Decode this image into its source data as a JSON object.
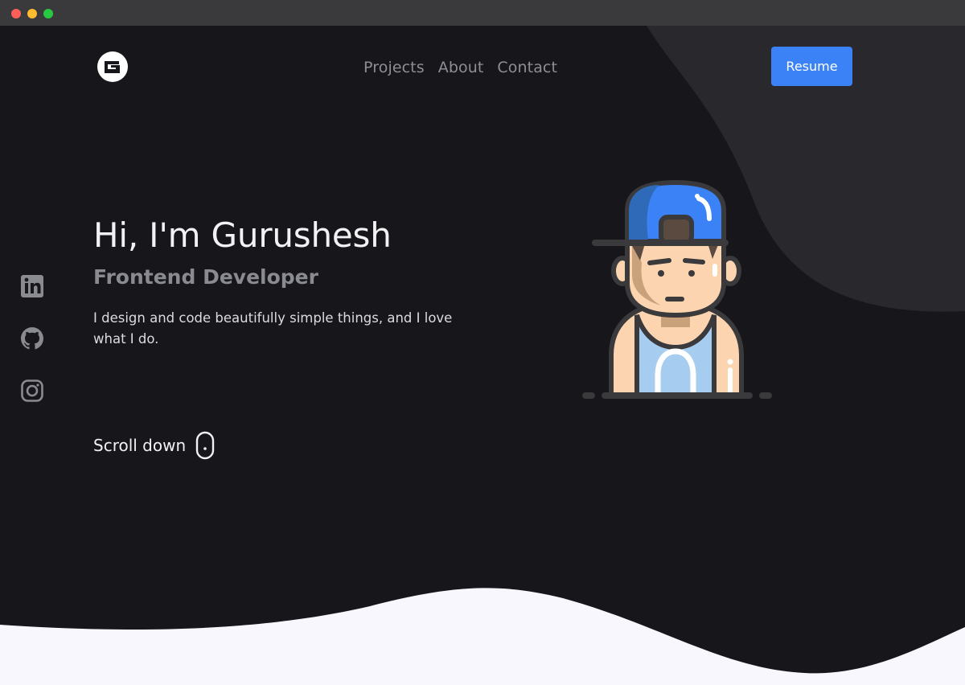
{
  "window": {
    "controls": [
      "close",
      "minimize",
      "maximize"
    ]
  },
  "header": {
    "logo_icon": "g-logo-icon",
    "nav": [
      {
        "label": "Projects"
      },
      {
        "label": "About"
      },
      {
        "label": "Contact"
      }
    ],
    "resume_label": "Resume"
  },
  "social": [
    {
      "icon": "linkedin-icon"
    },
    {
      "icon": "github-icon"
    },
    {
      "icon": "instagram-icon"
    }
  ],
  "hero": {
    "title": "Hi, I'm Gurushesh",
    "subtitle": "Frontend Developer",
    "description": "I design and code beautifully simple things, and I love what I do.",
    "scroll_label": "Scroll down"
  },
  "colors": {
    "background": "#16161b",
    "accent": "#3b82f6",
    "wave_light": "#f8f7fe",
    "corner_shape": "#28282d"
  }
}
